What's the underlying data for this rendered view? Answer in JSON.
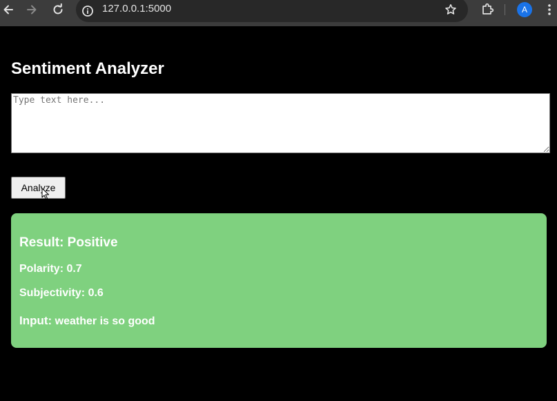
{
  "browser": {
    "url": "127.0.0.1:5000",
    "profile_initial": "A",
    "icons": [
      "back-arrow-icon",
      "forward-arrow-icon",
      "reload-icon",
      "site-info-icon",
      "bookmark-star-icon",
      "extensions-puzzle-icon",
      "kebab-menu-icon"
    ]
  },
  "page": {
    "title": "Sentiment Analyzer",
    "input_placeholder": "Type text here...",
    "input_value": "",
    "analyze_label": "Analyze"
  },
  "result": {
    "heading": "Result: Positive",
    "polarity": "Polarity: 0.7",
    "subjectivity": "Subjectivity: 0.6",
    "input_label": "Input:",
    "input_text": "weather is so good"
  },
  "colors": {
    "page_background": "#000000",
    "result_background": "#7fd17f",
    "result_text": "#ffffff",
    "avatar": "#1a73e8"
  }
}
